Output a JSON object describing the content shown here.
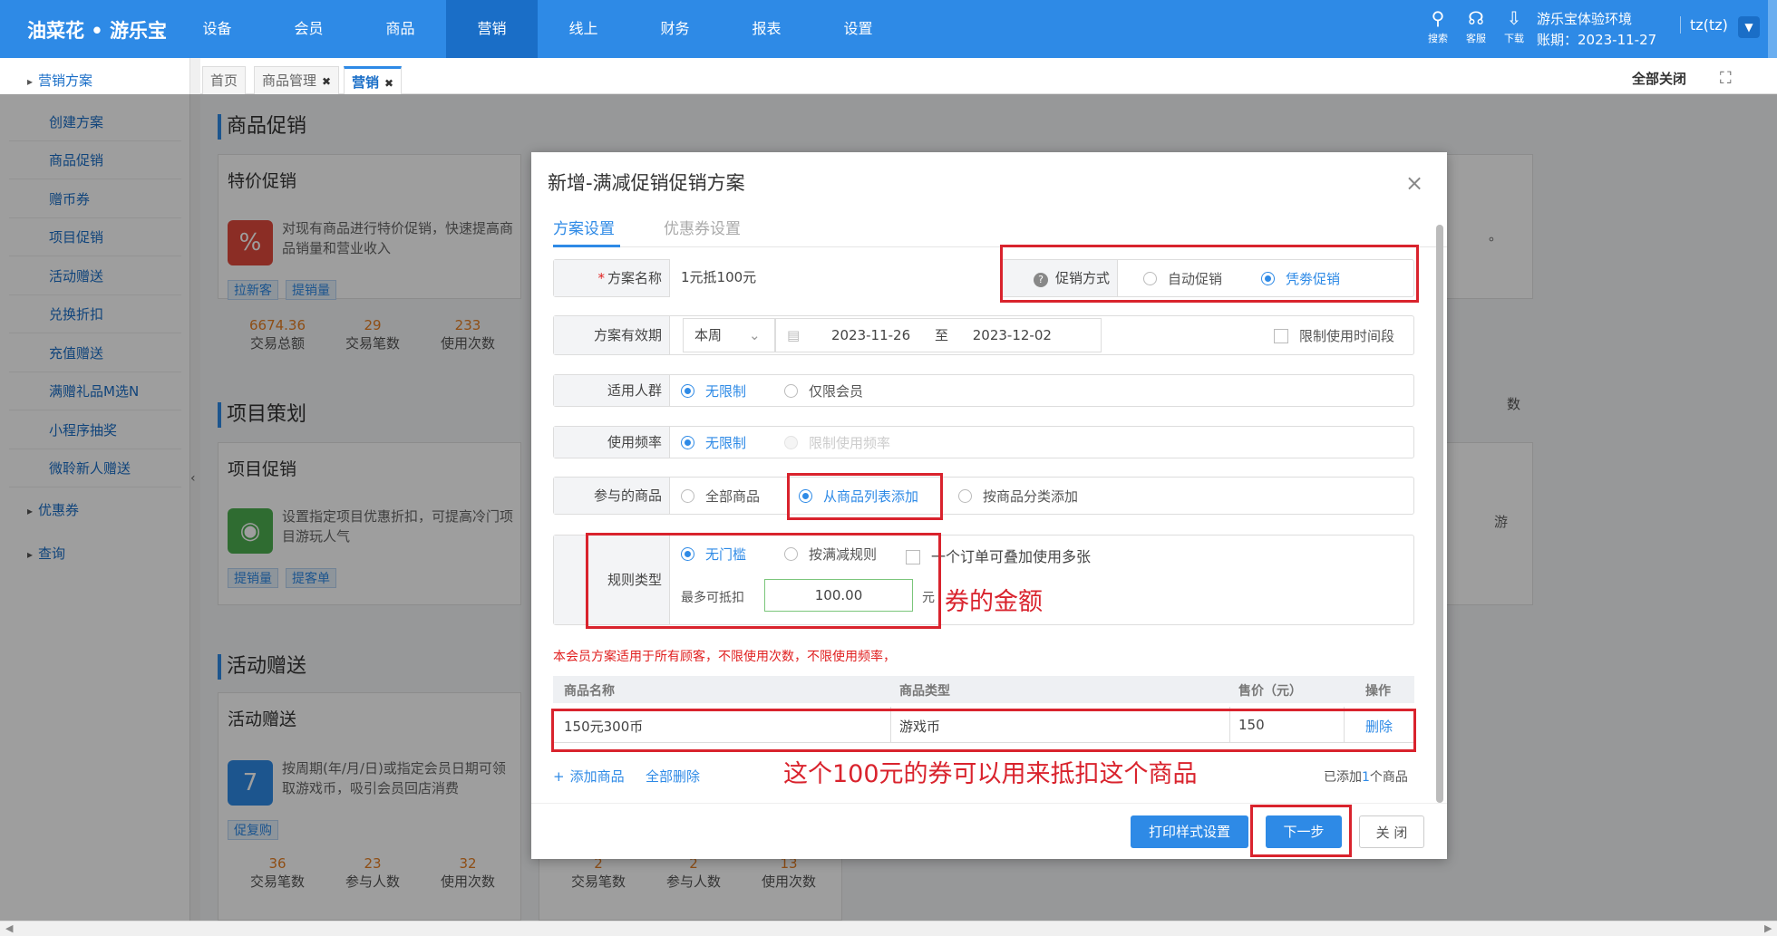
{
  "app": {
    "logo": "油菜花 • 游乐宝"
  },
  "topnav": [
    {
      "label": "设备"
    },
    {
      "label": "会员"
    },
    {
      "label": "商品"
    },
    {
      "label": "营销"
    },
    {
      "label": "线上"
    },
    {
      "label": "财务"
    },
    {
      "label": "报表"
    },
    {
      "label": "设置"
    }
  ],
  "topnav_active": "营销",
  "toolbar": {
    "search": "搜索",
    "service": "客服",
    "download": "下载"
  },
  "env": {
    "name": "游乐宝体验环境",
    "date": "账期：2023-11-27"
  },
  "user": {
    "name": "tz(tz)"
  },
  "sidebar": {
    "group1": "营销方案",
    "items": [
      "创建方案",
      "商品促销",
      "赠币券",
      "项目促销",
      "活动赠送",
      "兑换折扣",
      "充值赠送",
      "满赠礼品M选N",
      "小程序抽奖",
      "微聆新人赠送"
    ],
    "group2": "优惠券",
    "group3": "查询"
  },
  "tabs": [
    {
      "label": "首页"
    },
    {
      "label": "商品管理",
      "close": "✖"
    },
    {
      "label": "营销",
      "close": "✖"
    }
  ],
  "tabs_right": {
    "close_all": "全部关闭"
  },
  "page": {
    "section1": "商品促销",
    "card1": {
      "title": "特价促销",
      "desc": "对现有商品进行特价促销，快速提高商品销量和营业收入",
      "tags": [
        "拉新客",
        "提销量"
      ],
      "stats": [
        {
          "v": "6674.36",
          "l": "交易总额"
        },
        {
          "v": "29",
          "l": "交易笔数"
        },
        {
          "v": "233",
          "l": "使用次数"
        }
      ]
    },
    "section2": "项目策划",
    "card2": {
      "title": "项目促销",
      "desc": "设置指定项目优惠折扣，可提高冷门项目游玩人气",
      "tags": [
        "提销量",
        "提客单"
      ]
    },
    "section3": "活动赠送",
    "card3": {
      "title": "活动赠送",
      "desc": "按周期(年/月/日)或指定会员日期可领取游戏币，吸引会员回店消费",
      "tags": [
        "促复购"
      ],
      "stats": [
        {
          "v": "36",
          "l": "交易笔数"
        },
        {
          "v": "23",
          "l": "参与人数"
        },
        {
          "v": "32",
          "l": "使用次数"
        }
      ]
    },
    "card4": {
      "stats": [
        {
          "v": "2",
          "l": "交易笔数"
        },
        {
          "v": "2",
          "l": "参与人数"
        },
        {
          "v": "13",
          "l": "使用次数"
        }
      ]
    },
    "right_fragments": {
      "a": "。",
      "b": "数",
      "c": "游"
    }
  },
  "modal": {
    "title": "新增-满减促销促销方案",
    "close": "×",
    "tabs": [
      "方案设置",
      "优惠券设置"
    ],
    "name": {
      "label": "方案名称",
      "required": "*",
      "value": "1元抵100元"
    },
    "promo_method": {
      "label": "促销方式",
      "help": "?",
      "options": [
        "自动促销",
        "凭劵促销"
      ],
      "selected": "凭劵促销"
    },
    "validity": {
      "label": "方案有效期",
      "period": "本周",
      "start": "2023-11-26",
      "to": "至",
      "end": "2023-12-02",
      "limit_time": "限制使用时间段"
    },
    "audience": {
      "label": "适用人群",
      "options": [
        "无限制",
        "仅限会员"
      ],
      "selected": "无限制"
    },
    "frequency": {
      "label": "使用频率",
      "options": [
        "无限制",
        "限制使用频率"
      ],
      "selected": "无限制"
    },
    "products": {
      "label": "参与的商品",
      "options": [
        "全部商品",
        "从商品列表添加",
        "按商品分类添加"
      ],
      "selected": "从商品列表添加"
    },
    "rule": {
      "label": "规则类型",
      "options": [
        "无门槛",
        "按满减规则"
      ],
      "selected": "无门槛",
      "stack": "一个订单可叠加使用多张",
      "max_label": "最多可抵扣",
      "max_value": "100.00",
      "unit": "元"
    },
    "note": "本会员方案适用于所有顾客，不限使用次数，不限使用频率，",
    "table": {
      "headers": [
        "商品名称",
        "商品类型",
        "售价（元）",
        "操作"
      ],
      "rows": [
        {
          "name": "150元300币",
          "type": "游戏币",
          "price": "150",
          "op": "删除"
        }
      ]
    },
    "add_product": "添加商品",
    "delete_all": "全部删除",
    "added_prefix": "已添加",
    "added_count": "1",
    "added_suffix": "个商品",
    "buttons": {
      "print": "打印样式设置",
      "next": "下一步",
      "close": "关 闭"
    }
  },
  "annotations": {
    "amount": "券的金额",
    "deduct": "这个100元的券可以用来抵扣这个商品"
  },
  "colors": {
    "primary": "#2e8ae6",
    "annotation": "#d9232d",
    "orange_stat": "#e67e22"
  }
}
